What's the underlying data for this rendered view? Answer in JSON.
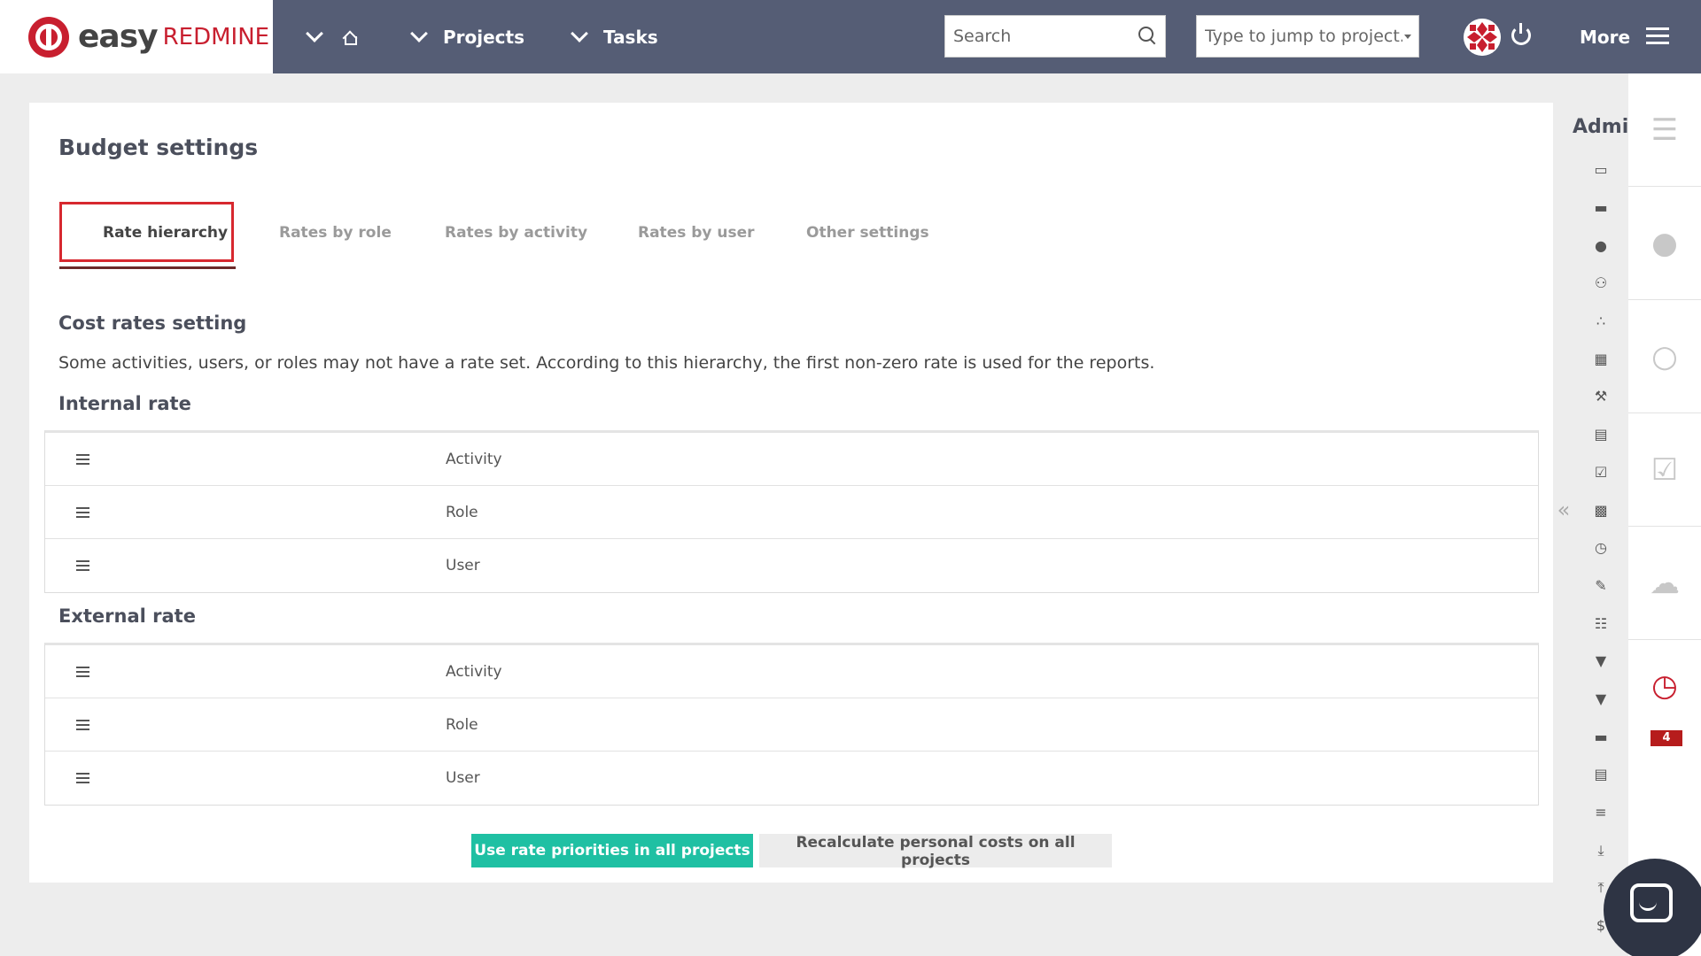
{
  "header": {
    "logo": {
      "easy": "easy",
      "redmine": "REDMINE"
    },
    "nav": {
      "projects_label": "Projects",
      "tasks_label": "Tasks",
      "more_label": "More"
    },
    "search": {
      "placeholder": "Search"
    },
    "jump": {
      "placeholder": "Type to jump to project..."
    }
  },
  "page": {
    "title": "Budget settings",
    "tabs": [
      {
        "label": "Rate hierarchy",
        "active": true
      },
      {
        "label": "Rates by role",
        "active": false
      },
      {
        "label": "Rates by activity",
        "active": false
      },
      {
        "label": "Rates by user",
        "active": false
      },
      {
        "label": "Other settings",
        "active": false
      }
    ],
    "cost_rates_heading": "Cost rates setting",
    "description": "Some activities, users, or roles may not have a rate set. According to this hierarchy, the first non-zero rate is used for the reports.",
    "internal_rate": {
      "heading": "Internal rate",
      "rows": [
        "Activity",
        "Role",
        "User"
      ]
    },
    "external_rate": {
      "heading": "External rate",
      "rows": [
        "Activity",
        "Role",
        "User"
      ]
    },
    "buttons": {
      "use_priorities": "Use rate priorities in all projects",
      "recalculate": "Recalculate personal costs on all projects"
    }
  },
  "admin_sidebar": {
    "title": "Admin",
    "collapse_glyph": "«",
    "icons": [
      "folder-outline-icon",
      "folder-icon",
      "user-icon",
      "users-icon",
      "group-icon",
      "calendar-icon",
      "wrench-icon",
      "clipboard-icon",
      "checklist-icon",
      "calculator-icon",
      "history-icon",
      "edit-icon",
      "grid-icon",
      "filter-icon",
      "filter-alt-icon",
      "database-icon",
      "document-icon",
      "stack-icon",
      "download-icon",
      "upload-icon",
      "dollar-icon"
    ]
  },
  "right_rail": {
    "timer_count": "4"
  },
  "colors": {
    "topbar": "#555d75",
    "accent_red": "#c81f2f",
    "primary_button": "#1fc0a3",
    "active_tab_border": "#d7282f"
  }
}
